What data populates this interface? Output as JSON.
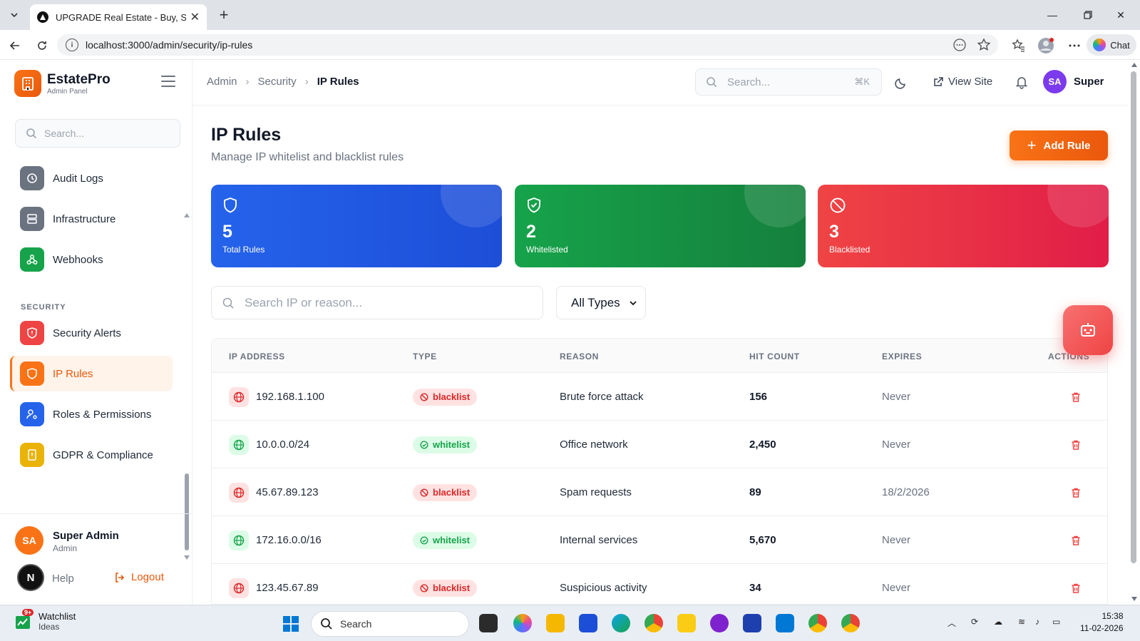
{
  "browser": {
    "tab_title": "UPGRADE Real Estate - Buy, Sell &",
    "url": "localhost:3000/admin/security/ip-rules",
    "chat_label": "Chat"
  },
  "sidebar": {
    "brand_name": "EstatePro",
    "brand_sub": "Admin Panel",
    "search_placeholder": "Search...",
    "items": [
      {
        "label": "Audit Logs",
        "icon": "history-icon",
        "color": "#6b7280"
      },
      {
        "label": "Infrastructure",
        "icon": "server-icon",
        "color": "#6b7280"
      },
      {
        "label": "Webhooks",
        "icon": "webhook-icon",
        "color": "#16a34a"
      },
      {
        "label": "Security Alerts",
        "icon": "shield-alert-icon",
        "color": "#ef4444"
      },
      {
        "label": "IP Rules",
        "icon": "shield-icon",
        "color": "#f97316"
      },
      {
        "label": "Roles & Permissions",
        "icon": "user-cog-icon",
        "color": "#2563eb"
      },
      {
        "label": "GDPR & Compliance",
        "icon": "file-shield-icon",
        "color": "#eab308"
      }
    ],
    "section_security": "SECURITY",
    "user_initials": "SA",
    "user_name": "Super Admin",
    "user_role": "Admin",
    "help_label": "Help",
    "logout_label": "Logout",
    "n_avatar": "N"
  },
  "topbar": {
    "breadcrumb": [
      "Admin",
      "Security",
      "IP Rules"
    ],
    "search_placeholder": "Search...",
    "shortcut": "⌘K",
    "view_site": "View Site",
    "avatar_initials": "SA",
    "user_short": "Super"
  },
  "page": {
    "title": "IP Rules",
    "subtitle": "Manage IP whitelist and blacklist rules",
    "add_button": "Add Rule"
  },
  "stats": [
    {
      "value": "5",
      "label": "Total Rules",
      "color_from": "#2563eb",
      "color_to": "#1d4ed8",
      "icon": "shield-icon"
    },
    {
      "value": "2",
      "label": "Whitelisted",
      "color_from": "#16a34a",
      "color_to": "#15803d",
      "icon": "shield-check-icon"
    },
    {
      "value": "3",
      "label": "Blacklisted",
      "color_from": "#ef4444",
      "color_to": "#e11d48",
      "icon": "ban-icon"
    }
  ],
  "filters": {
    "search_placeholder": "Search IP or reason...",
    "type_selected": "All Types"
  },
  "table": {
    "headers": [
      "IP ADDRESS",
      "TYPE",
      "REASON",
      "HIT COUNT",
      "EXPIRES",
      "ACTIONS"
    ],
    "rows": [
      {
        "ip": "192.168.1.100",
        "type": "blacklist",
        "reason": "Brute force attack",
        "hits": "156",
        "expires": "Never"
      },
      {
        "ip": "10.0.0.0/24",
        "type": "whitelist",
        "reason": "Office network",
        "hits": "2,450",
        "expires": "Never"
      },
      {
        "ip": "45.67.89.123",
        "type": "blacklist",
        "reason": "Spam requests",
        "hits": "89",
        "expires": "18/2/2026"
      },
      {
        "ip": "172.16.0.0/16",
        "type": "whitelist",
        "reason": "Internal services",
        "hits": "5,670",
        "expires": "Never"
      },
      {
        "ip": "123.45.67.89",
        "type": "blacklist",
        "reason": "Suspicious activity",
        "hits": "34",
        "expires": "Never"
      }
    ]
  },
  "taskbar": {
    "watch_title": "Watchlist",
    "watch_sub": "Ideas",
    "watch_badge": "9+",
    "search_label": "Search",
    "time": "15:38",
    "date": "11-02-2026"
  }
}
